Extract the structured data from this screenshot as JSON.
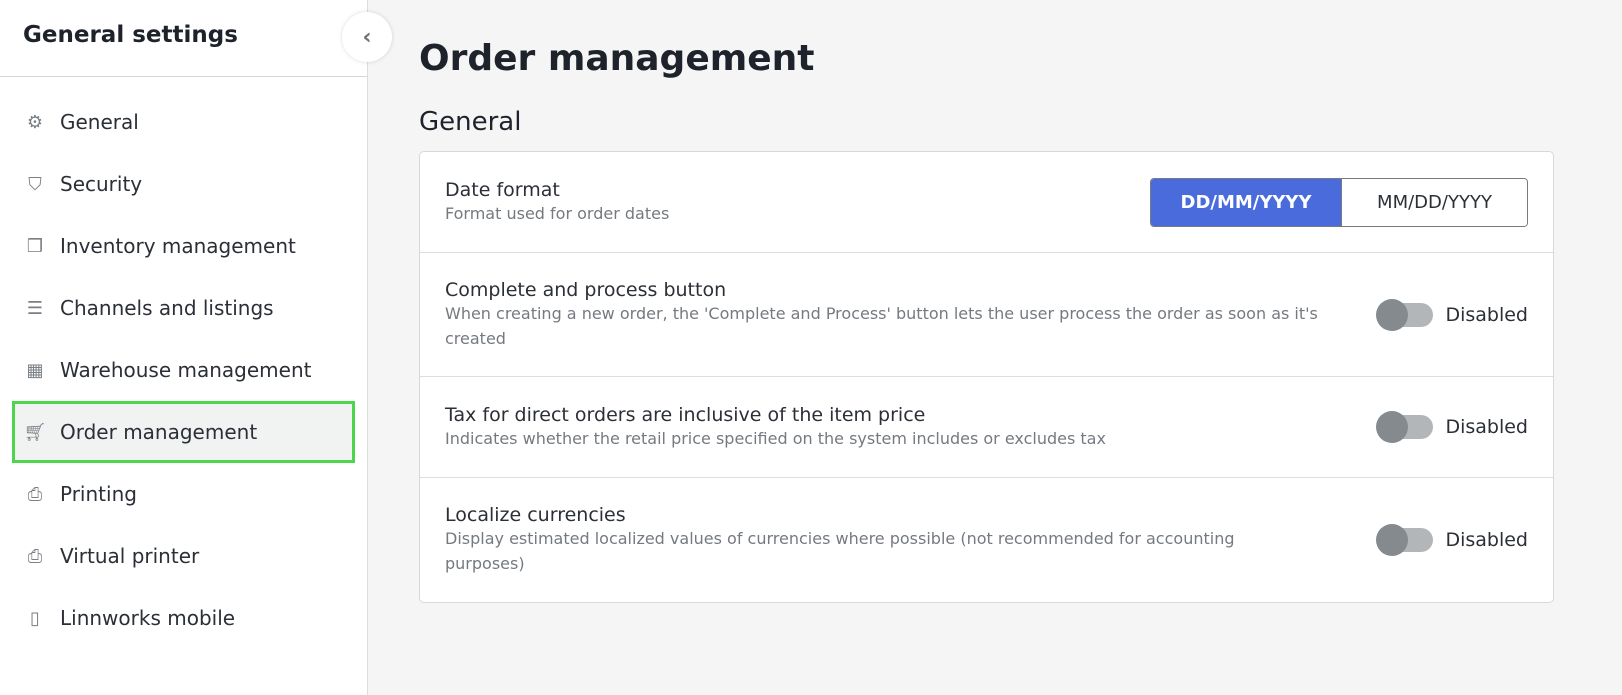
{
  "sidebar": {
    "title": "General settings",
    "items": [
      {
        "label": "General",
        "icon": "gear-icon"
      },
      {
        "label": "Security",
        "icon": "shield-icon"
      },
      {
        "label": "Inventory management",
        "icon": "cubes-icon"
      },
      {
        "label": "Channels and listings",
        "icon": "list-icon"
      },
      {
        "label": "Warehouse management",
        "icon": "building-icon"
      },
      {
        "label": "Order management",
        "icon": "cart-icon",
        "active": true
      },
      {
        "label": "Printing",
        "icon": "printer-icon"
      },
      {
        "label": "Virtual printer",
        "icon": "printer-icon"
      },
      {
        "label": "Linnworks mobile",
        "icon": "mobile-icon"
      }
    ]
  },
  "main": {
    "title": "Order management",
    "section": "General",
    "date_format": {
      "title": "Date format",
      "desc": "Format used for order dates",
      "options": [
        "DD/MM/YYYY",
        "MM/DD/YYYY"
      ],
      "selected": "DD/MM/YYYY"
    },
    "settings": [
      {
        "title": "Complete and process button",
        "desc": "When creating a new order, the 'Complete and Process' button lets the user process the order as soon as it's created",
        "state": "Disabled"
      },
      {
        "title": "Tax for direct orders are inclusive of the item price",
        "desc": "Indicates whether the retail price specified on the system includes or excludes tax",
        "state": "Disabled"
      },
      {
        "title": "Localize currencies",
        "desc": "Display estimated localized values of currencies where possible (not recommended for accounting purposes)",
        "state": "Disabled"
      }
    ]
  },
  "colors": {
    "accent": "#4a6bdc",
    "active_outline": "#4cd64c"
  }
}
